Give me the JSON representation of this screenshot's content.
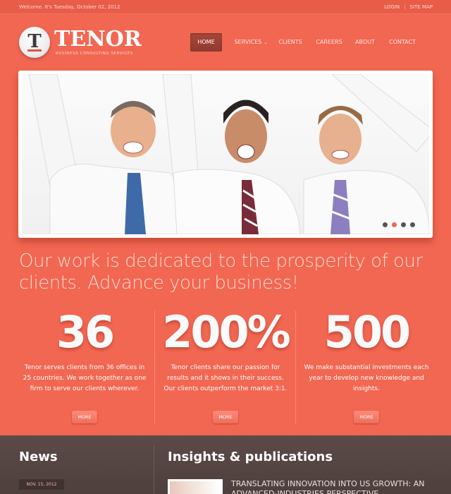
{
  "topbar": {
    "welcome": "Welcome. It's Tuesday, October 02, 2012",
    "login": "LOGIN",
    "separator": "|",
    "sitemap": "SITE MAP"
  },
  "logo": {
    "badge_letter": "T",
    "name": "TENOR",
    "tagline": "BUSINESS CONSULTING SERVICES"
  },
  "nav": {
    "items": [
      {
        "label": "HOME",
        "active": true
      },
      {
        "label": "SERVICES",
        "has_dropdown": true
      },
      {
        "label": "CLIENTS"
      },
      {
        "label": "CAREERS"
      },
      {
        "label": "ABOUT"
      },
      {
        "label": "CONTACT"
      }
    ],
    "caret": "⌄"
  },
  "slider": {
    "dot_count": 4,
    "active_dot": 2
  },
  "headline": "Our work is dedicated to the prosperity of our clients. Advance your business!",
  "stats": [
    {
      "number": "36",
      "desc": "Tenor serves clients from 36 offices in 25 countries. We work together as one firm to serve our clients wherever.",
      "button": "MORE"
    },
    {
      "number": "200%",
      "desc": "Tenor clients share our passion for results and it shows in their success. Our clients outperform the market 3:1.",
      "button": "MORE"
    },
    {
      "number": "500",
      "desc": "We make substantial investments each year to develop new knowledge and insights.",
      "button": "MORE"
    }
  ],
  "news": {
    "title": "News",
    "date": "NOV. 15, 2012"
  },
  "insights": {
    "title": "Insights & publications",
    "article": "TRANSLATING INNOVATION INTO US GROWTH: AN ADVANCED-INDUSTRIES PERSPECTIVE"
  },
  "colors": {
    "brand": "#f26752",
    "active_nav": "#9b3f34",
    "footer_bg": "#544443"
  }
}
